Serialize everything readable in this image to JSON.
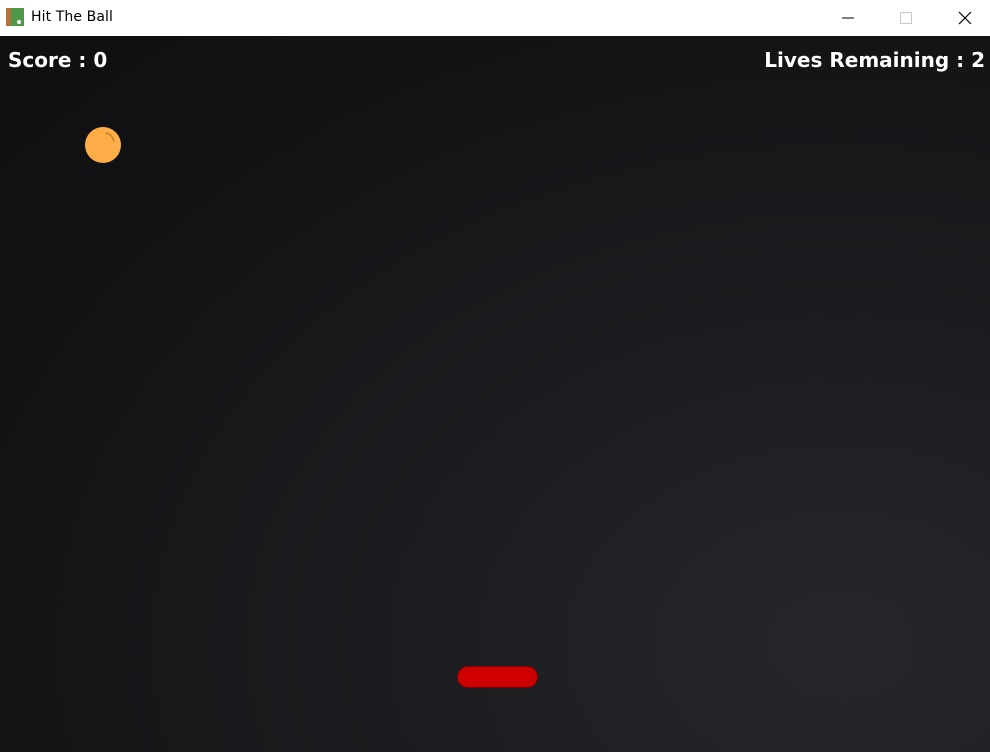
{
  "window": {
    "title": "Hit The Ball",
    "icon": "game-app-icon",
    "controls": {
      "minimize_icon": "minimize-icon",
      "maximize_icon": "maximize-icon",
      "close_icon": "close-icon"
    }
  },
  "hud": {
    "score_text": "Score : 0",
    "lives_text": "Lives Remaining : 2"
  },
  "colors": {
    "ball": "#ffad47",
    "paddle": "#d00000",
    "hud_text": "#ffffff",
    "background": "#131315"
  }
}
